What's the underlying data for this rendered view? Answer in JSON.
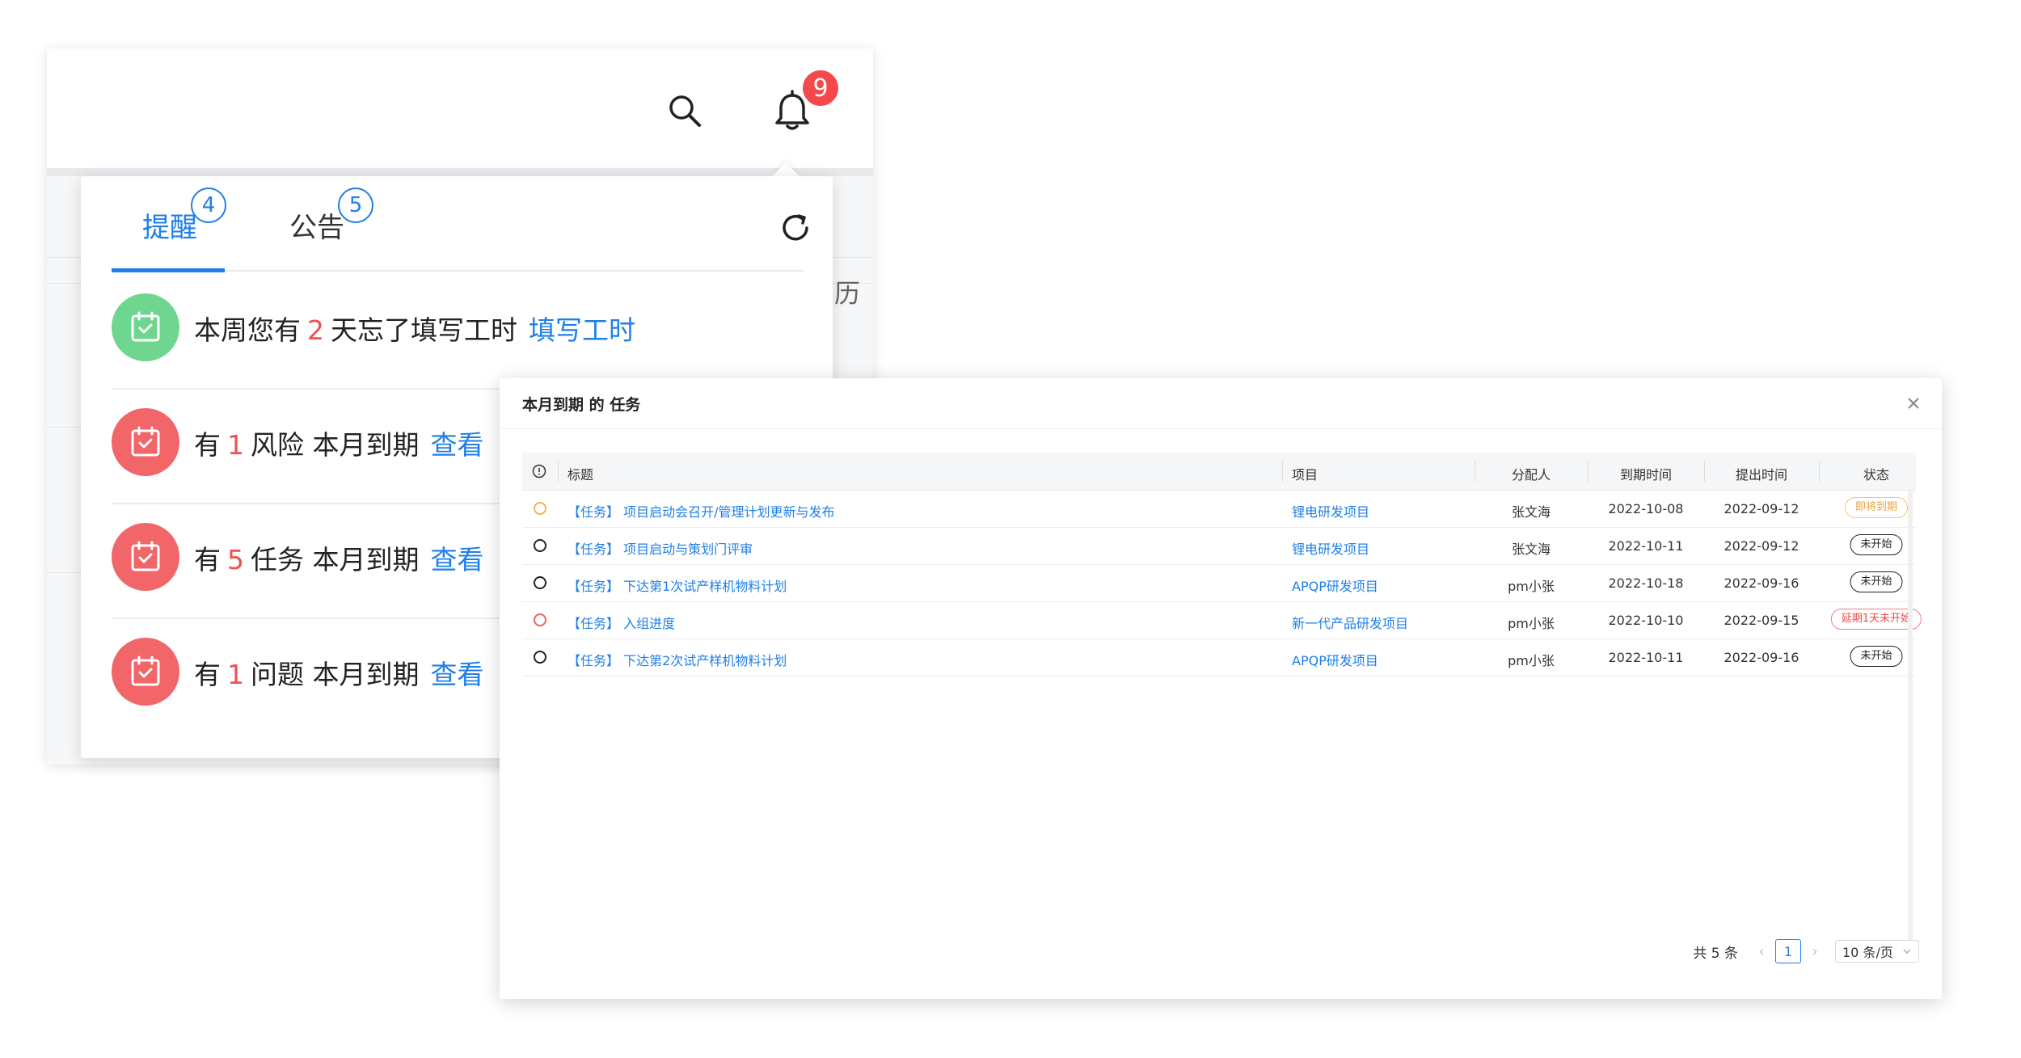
{
  "header": {
    "notification_count": "9",
    "side_text": "历"
  },
  "popover": {
    "tabs": [
      {
        "label": "提醒",
        "badge": "4"
      },
      {
        "label": "公告",
        "badge": "5"
      }
    ],
    "items": [
      {
        "prefix": "本周您有",
        "num": "2",
        "suffix": "天忘了填写工时",
        "link": "填写工时",
        "color": "green"
      },
      {
        "prefix": "有",
        "num": "1",
        "suffix": "风险 本月到期",
        "link": "查看",
        "color": "red"
      },
      {
        "prefix": "有",
        "num": "5",
        "suffix": "任务 本月到期",
        "link": "查看",
        "color": "red"
      },
      {
        "prefix": "有",
        "num": "1",
        "suffix": "问题 本月到期",
        "link": "查看",
        "color": "red"
      }
    ]
  },
  "modal": {
    "title": "本月到期 的 任务",
    "columns": {
      "title": "标题",
      "project": "项目",
      "assignee": "分配人",
      "due": "到期时间",
      "created": "提出时间",
      "status": "状态"
    },
    "rows": [
      {
        "dot": "orange",
        "title": "【任务】 项目启动会召开/管理计划更新与发布",
        "project": "锂电研发项目",
        "assignee": "张文海",
        "due": "2022-10-08",
        "created": "2022-09-12",
        "status": "即将到期",
        "status_type": "warn"
      },
      {
        "dot": "black",
        "title": "【任务】 项目启动与策划门评审",
        "project": "锂电研发项目",
        "assignee": "张文海",
        "due": "2022-10-11",
        "created": "2022-09-12",
        "status": "未开始",
        "status_type": "normal"
      },
      {
        "dot": "black",
        "title": "【任务】 下达第1次试产样机物料计划",
        "project": "APQP研发项目",
        "assignee": "pm小张",
        "due": "2022-10-18",
        "created": "2022-09-16",
        "status": "未开始",
        "status_type": "normal"
      },
      {
        "dot": "red",
        "title": "【任务】 入组进度",
        "project": "新一代产品研发项目",
        "assignee": "pm小张",
        "due": "2022-10-10",
        "created": "2022-09-15",
        "status": "延期1天未开始",
        "status_type": "danger"
      },
      {
        "dot": "black",
        "title": "【任务】 下达第2次试产样机物料计划",
        "project": "APQP研发项目",
        "assignee": "pm小张",
        "due": "2022-10-11",
        "created": "2022-09-16",
        "status": "未开始",
        "status_type": "normal"
      }
    ],
    "pagination": {
      "total": "共 5 条",
      "current_page": "1",
      "page_size": "10 条/页"
    }
  }
}
